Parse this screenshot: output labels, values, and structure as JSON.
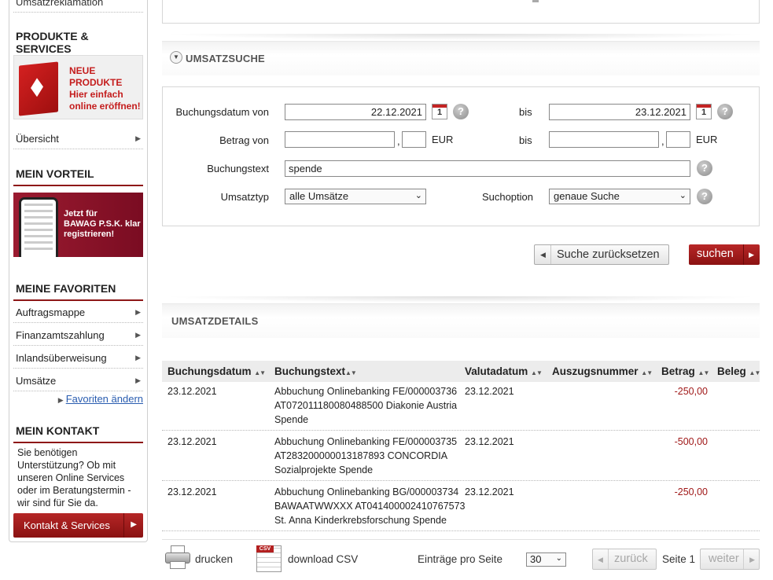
{
  "sidebar": {
    "top_item": "Umsatzreklamation",
    "produkte_heading": "PRODUKTE & SERVICES",
    "banner_neu": {
      "line1": "NEUE",
      "line2": "PRODUKTE",
      "line3": "Hier einfach",
      "line4": "online eröffnen!"
    },
    "uebersicht": "Übersicht",
    "vorteil_heading": "MEIN VORTEIL",
    "banner_bawag": {
      "line1": "Jetzt für",
      "line2": "BAWAG P.S.K. klar",
      "line3": "registrieren!"
    },
    "favoriten_heading": "MEINE FAVORITEN",
    "favorites": [
      "Auftragsmappe",
      "Finanzamtszahlung",
      "Inlandsüberweisung",
      "Umsätze"
    ],
    "favoriten_aendern": "Favoriten ändern",
    "kontakt_heading": "MEIN KONTAKT",
    "kontakt_text": "Sie benötigen Unterstützung? Ob mit unseren Online Services oder im Beratungstermin - wir sind für Sie da.",
    "kontakt_button": "Kontakt & Services"
  },
  "umsatzsuche": {
    "title": "UMSATZSUCHE",
    "buchungsdatum_von_label": "Buchungsdatum von",
    "buchungsdatum_von": "22.12.2021",
    "bis_label": "bis",
    "buchungsdatum_bis": "23.12.2021",
    "calendar_day": "1",
    "betrag_von_label": "Betrag von",
    "betrag_von": "",
    "betrag_von_cents": "",
    "betrag_bis": "",
    "betrag_bis_cents": "",
    "comma": ",",
    "currency": "EUR",
    "buchungstext_label": "Buchungstext",
    "buchungstext": "spende",
    "umsatztyp_label": "Umsatztyp",
    "umsatztyp": "alle Umsätze",
    "suchoption_label": "Suchoption",
    "suchoption": "genaue Suche",
    "help": "?",
    "reset_button": "Suche zurücksetzen",
    "search_button": "suchen"
  },
  "umsatzdetails": {
    "title": "UMSATZDETAILS",
    "columns": [
      "Buchungsdatum",
      "Buchungstext",
      "Valutadatum",
      "Auszugsnummer",
      "Betrag",
      "Beleg"
    ],
    "sort_glyph": "▲▼",
    "rows": [
      {
        "buchungsdatum": "23.12.2021",
        "text1": "Abbuchung Onlinebanking FE/000003736",
        "text2": "AT072011180080488500 Diakonie Austria",
        "text3": "Spende",
        "valutadatum": "23.12.2021",
        "betrag": "-250,00"
      },
      {
        "buchungsdatum": "23.12.2021",
        "text1": "Abbuchung Onlinebanking FE/000003735",
        "text2": "AT283200000013187893 CONCORDIA",
        "text3": "Sozialprojekte Spende",
        "valutadatum": "23.12.2021",
        "betrag": "-500,00"
      },
      {
        "buchungsdatum": "23.12.2021",
        "text1": "Abbuchung Onlinebanking BG/000003734",
        "text2": "BAWAATWWXXX AT041400002410767573",
        "text3": "St. Anna Kinderkrebsforschung Spende",
        "valutadatum": "23.12.2021",
        "betrag": "-250,00"
      }
    ]
  },
  "footer": {
    "print": "drucken",
    "csv_tag": "CSV",
    "download_csv": "download CSV",
    "entries_label": "Einträge pro Seite",
    "entries_value": "30",
    "back": "zurück",
    "page": "Seite 1",
    "next": "weiter"
  }
}
